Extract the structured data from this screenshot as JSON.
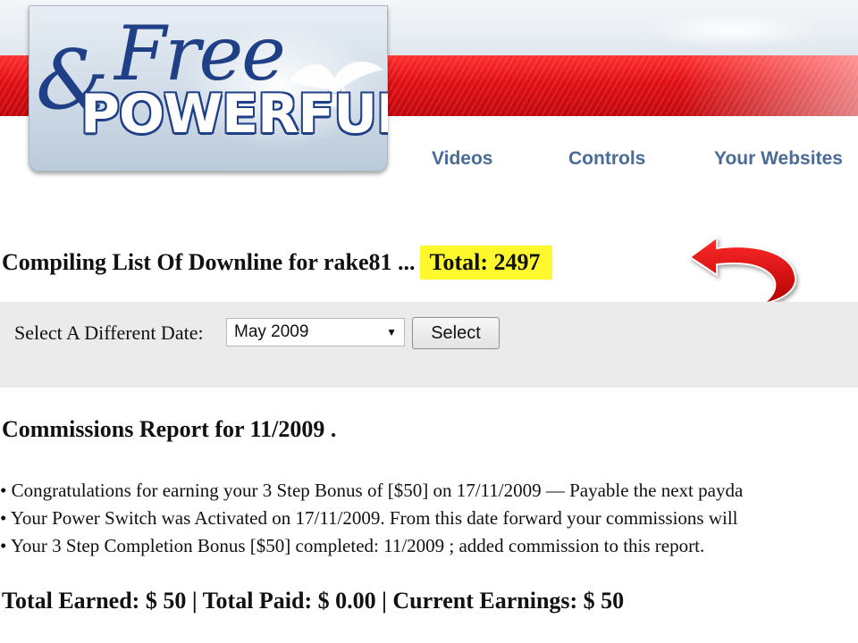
{
  "logo": {
    "amp": "&",
    "free": "Free",
    "powerful": "POWERFUL"
  },
  "nav": {
    "items": [
      "Videos",
      "Controls",
      "Your Websites"
    ]
  },
  "downline": {
    "text": "Compiling List Of Downline for rake81 ...",
    "total": "Total: 2497"
  },
  "date_form": {
    "label": "Select A Different Date:",
    "selected": "May 2009",
    "button": "Select"
  },
  "report": {
    "title": "Commissions Report for 11/2009 .",
    "bullets": [
      "• Congratulations for earning your 3 Step Bonus of [$50] on 17/11/2009 — Payable the next payda",
      "• Your Power Switch was Activated on 17/11/2009. From this date forward your commissions will",
      "• Your 3 Step Completion Bonus [$50] completed: 11/2009 ; added commission to this report."
    ],
    "totals": "Total Earned: $ 50 | Total Paid: $ 0.00 | Current Earnings: $ 50"
  },
  "colors": {
    "accent_red": "#e00f14",
    "logo_blue": "#1f3f86",
    "nav_blue": "#4a6b96",
    "highlight_yellow": "#fff82c"
  }
}
